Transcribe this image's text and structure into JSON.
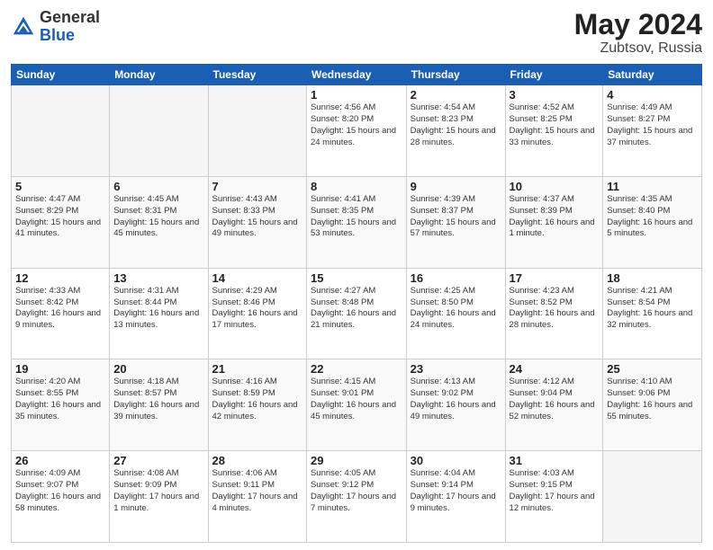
{
  "header": {
    "logo_general": "General",
    "logo_blue": "Blue",
    "title": "May 2024",
    "location": "Zubtsov, Russia"
  },
  "columns": [
    "Sunday",
    "Monday",
    "Tuesday",
    "Wednesday",
    "Thursday",
    "Friday",
    "Saturday"
  ],
  "weeks": [
    [
      {
        "day": "",
        "info": ""
      },
      {
        "day": "",
        "info": ""
      },
      {
        "day": "",
        "info": ""
      },
      {
        "day": "1",
        "info": "Sunrise: 4:56 AM\nSunset: 8:20 PM\nDaylight: 15 hours\nand 24 minutes."
      },
      {
        "day": "2",
        "info": "Sunrise: 4:54 AM\nSunset: 8:23 PM\nDaylight: 15 hours\nand 28 minutes."
      },
      {
        "day": "3",
        "info": "Sunrise: 4:52 AM\nSunset: 8:25 PM\nDaylight: 15 hours\nand 33 minutes."
      },
      {
        "day": "4",
        "info": "Sunrise: 4:49 AM\nSunset: 8:27 PM\nDaylight: 15 hours\nand 37 minutes."
      }
    ],
    [
      {
        "day": "5",
        "info": "Sunrise: 4:47 AM\nSunset: 8:29 PM\nDaylight: 15 hours\nand 41 minutes."
      },
      {
        "day": "6",
        "info": "Sunrise: 4:45 AM\nSunset: 8:31 PM\nDaylight: 15 hours\nand 45 minutes."
      },
      {
        "day": "7",
        "info": "Sunrise: 4:43 AM\nSunset: 8:33 PM\nDaylight: 15 hours\nand 49 minutes."
      },
      {
        "day": "8",
        "info": "Sunrise: 4:41 AM\nSunset: 8:35 PM\nDaylight: 15 hours\nand 53 minutes."
      },
      {
        "day": "9",
        "info": "Sunrise: 4:39 AM\nSunset: 8:37 PM\nDaylight: 15 hours\nand 57 minutes."
      },
      {
        "day": "10",
        "info": "Sunrise: 4:37 AM\nSunset: 8:39 PM\nDaylight: 16 hours\nand 1 minute."
      },
      {
        "day": "11",
        "info": "Sunrise: 4:35 AM\nSunset: 8:40 PM\nDaylight: 16 hours\nand 5 minutes."
      }
    ],
    [
      {
        "day": "12",
        "info": "Sunrise: 4:33 AM\nSunset: 8:42 PM\nDaylight: 16 hours\nand 9 minutes."
      },
      {
        "day": "13",
        "info": "Sunrise: 4:31 AM\nSunset: 8:44 PM\nDaylight: 16 hours\nand 13 minutes."
      },
      {
        "day": "14",
        "info": "Sunrise: 4:29 AM\nSunset: 8:46 PM\nDaylight: 16 hours\nand 17 minutes."
      },
      {
        "day": "15",
        "info": "Sunrise: 4:27 AM\nSunset: 8:48 PM\nDaylight: 16 hours\nand 21 minutes."
      },
      {
        "day": "16",
        "info": "Sunrise: 4:25 AM\nSunset: 8:50 PM\nDaylight: 16 hours\nand 24 minutes."
      },
      {
        "day": "17",
        "info": "Sunrise: 4:23 AM\nSunset: 8:52 PM\nDaylight: 16 hours\nand 28 minutes."
      },
      {
        "day": "18",
        "info": "Sunrise: 4:21 AM\nSunset: 8:54 PM\nDaylight: 16 hours\nand 32 minutes."
      }
    ],
    [
      {
        "day": "19",
        "info": "Sunrise: 4:20 AM\nSunset: 8:55 PM\nDaylight: 16 hours\nand 35 minutes."
      },
      {
        "day": "20",
        "info": "Sunrise: 4:18 AM\nSunset: 8:57 PM\nDaylight: 16 hours\nand 39 minutes."
      },
      {
        "day": "21",
        "info": "Sunrise: 4:16 AM\nSunset: 8:59 PM\nDaylight: 16 hours\nand 42 minutes."
      },
      {
        "day": "22",
        "info": "Sunrise: 4:15 AM\nSunset: 9:01 PM\nDaylight: 16 hours\nand 45 minutes."
      },
      {
        "day": "23",
        "info": "Sunrise: 4:13 AM\nSunset: 9:02 PM\nDaylight: 16 hours\nand 49 minutes."
      },
      {
        "day": "24",
        "info": "Sunrise: 4:12 AM\nSunset: 9:04 PM\nDaylight: 16 hours\nand 52 minutes."
      },
      {
        "day": "25",
        "info": "Sunrise: 4:10 AM\nSunset: 9:06 PM\nDaylight: 16 hours\nand 55 minutes."
      }
    ],
    [
      {
        "day": "26",
        "info": "Sunrise: 4:09 AM\nSunset: 9:07 PM\nDaylight: 16 hours\nand 58 minutes."
      },
      {
        "day": "27",
        "info": "Sunrise: 4:08 AM\nSunset: 9:09 PM\nDaylight: 17 hours\nand 1 minute."
      },
      {
        "day": "28",
        "info": "Sunrise: 4:06 AM\nSunset: 9:11 PM\nDaylight: 17 hours\nand 4 minutes."
      },
      {
        "day": "29",
        "info": "Sunrise: 4:05 AM\nSunset: 9:12 PM\nDaylight: 17 hours\nand 7 minutes."
      },
      {
        "day": "30",
        "info": "Sunrise: 4:04 AM\nSunset: 9:14 PM\nDaylight: 17 hours\nand 9 minutes."
      },
      {
        "day": "31",
        "info": "Sunrise: 4:03 AM\nSunset: 9:15 PM\nDaylight: 17 hours\nand 12 minutes."
      },
      {
        "day": "",
        "info": ""
      }
    ]
  ]
}
